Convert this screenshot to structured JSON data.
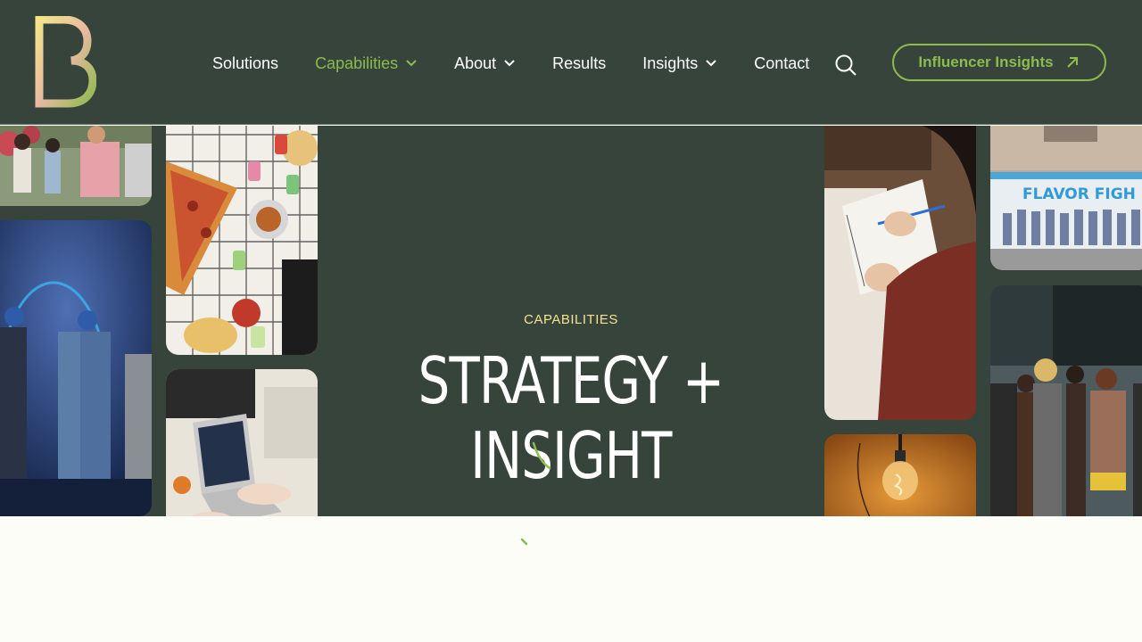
{
  "header": {
    "logo_alt": "B",
    "nav": [
      {
        "label": "Solutions",
        "has_dropdown": false,
        "active": false
      },
      {
        "label": "Capabilities",
        "has_dropdown": true,
        "active": true
      },
      {
        "label": "About",
        "has_dropdown": true,
        "active": false
      },
      {
        "label": "Results",
        "has_dropdown": false,
        "active": false
      },
      {
        "label": "Insights",
        "has_dropdown": true,
        "active": false
      },
      {
        "label": "Contact",
        "has_dropdown": false,
        "active": false
      }
    ],
    "search_icon": "search-icon",
    "cta_label": "Influencer Insights",
    "cta_icon": "arrow-up-right-icon"
  },
  "hero": {
    "eyebrow": "CAPABILITIES",
    "title": "STRATEGY + INSIGHT",
    "food_truck_sign": "FLAVOR FIGH"
  },
  "colors": {
    "header_bg": "#37443b",
    "accent_green": "#8dbb4e",
    "eyebrow_yellow": "#f3e48a",
    "page_bg": "#fdfdf8"
  }
}
